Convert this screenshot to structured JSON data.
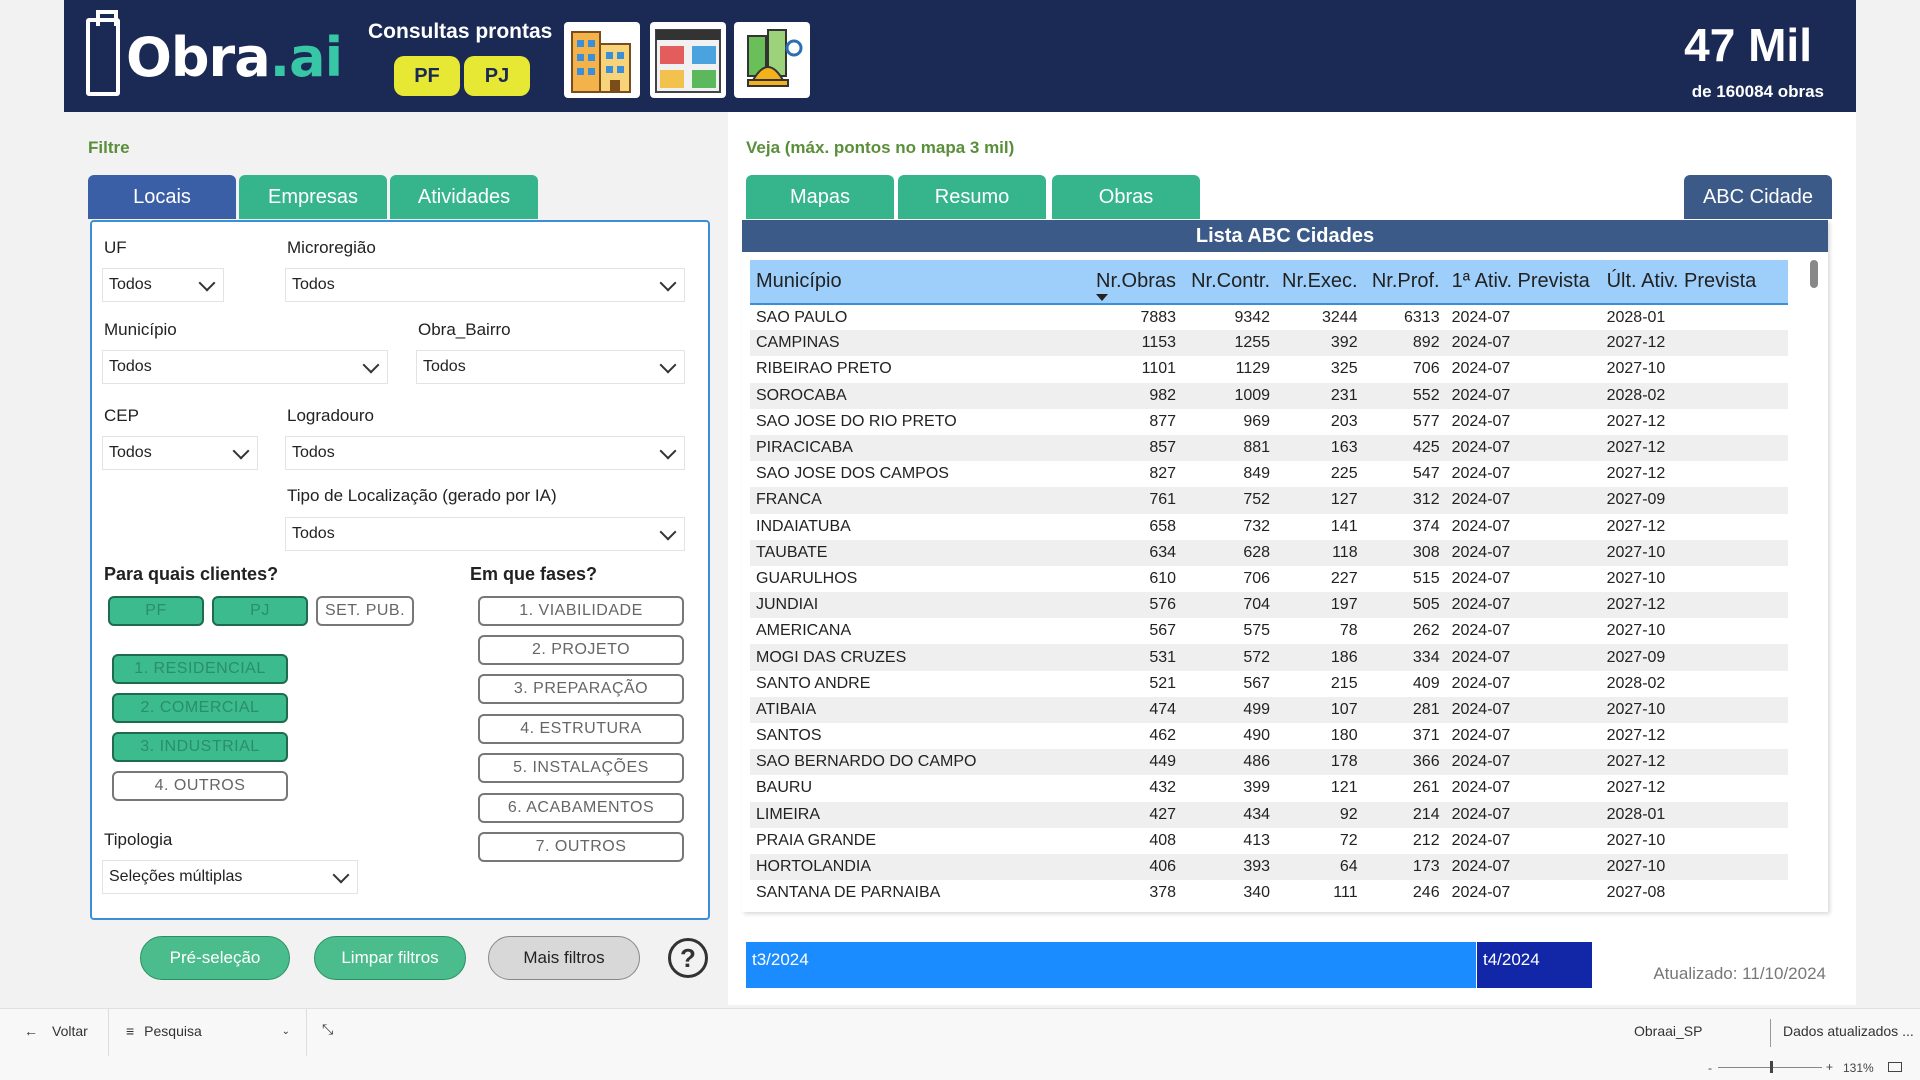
{
  "header": {
    "logo_main": "Obra",
    "logo_accent": ".ai",
    "consultas_label": "Consultas prontas",
    "btn_pf": "PF",
    "btn_pj": "PJ",
    "stat_big": "47 Mil",
    "stat_small": "de 160084 obras"
  },
  "left": {
    "section_label": "Filtre",
    "tabs": [
      "Locais",
      "Empresas",
      "Atividades"
    ],
    "filters": {
      "uf_label": "UF",
      "uf_value": "Todos",
      "micro_label": "Microregião",
      "micro_value": "Todos",
      "municipio_label": "Município",
      "municipio_value": "Todos",
      "bairro_label": "Obra_Bairro",
      "bairro_value": "Todos",
      "cep_label": "CEP",
      "cep_value": "Todos",
      "logradouro_label": "Logradouro",
      "logradouro_value": "Todos",
      "tipo_label": "Tipo de Localização (gerado por IA)",
      "tipo_value": "Todos",
      "tipologia_label": "Tipologia",
      "tipologia_value": "Seleções múltiplas"
    },
    "clientes_label": "Para quais clientes?",
    "clientes": [
      "PF",
      "PJ",
      "SET. PUB."
    ],
    "segmentos": [
      "1. RESIDENCIAL",
      "2. COMERCIAL",
      "3. INDUSTRIAL",
      "4. OUTROS"
    ],
    "fases_label": "Em que fases?",
    "fases": [
      "1. VIABILIDADE",
      "2. PROJETO",
      "3. PREPARAÇÃO",
      "4. ESTRUTURA",
      "5. INSTALAÇÕES",
      "6. ACABAMENTOS",
      "7. OUTROS"
    ],
    "buttons": {
      "preselecao": "Pré-seleção",
      "limpar": "Limpar filtros",
      "mais": "Mais filtros",
      "help": "?"
    }
  },
  "right": {
    "section_label": "Veja (máx. pontos no mapa 3 mil)",
    "tabs": [
      "Mapas",
      "Resumo",
      "Obras"
    ],
    "active_tab": "ABC Cidade",
    "table_title": "Lista ABC Cidades",
    "columns": [
      "Município",
      "Nr.Obras",
      "Nr.Contr.",
      "Nr.Exec.",
      "Nr.Prof.",
      "1ª Ativ. Prevista",
      "Últ. Ativ. Prevista"
    ],
    "rows": [
      [
        "SAO PAULO",
        "7883",
        "9342",
        "3244",
        "6313",
        "2024-07",
        "2028-01"
      ],
      [
        "CAMPINAS",
        "1153",
        "1255",
        "392",
        "892",
        "2024-07",
        "2027-12"
      ],
      [
        "RIBEIRAO PRETO",
        "1101",
        "1129",
        "325",
        "706",
        "2024-07",
        "2027-10"
      ],
      [
        "SOROCABA",
        "982",
        "1009",
        "231",
        "552",
        "2024-07",
        "2028-02"
      ],
      [
        "SAO JOSE DO RIO PRETO",
        "877",
        "969",
        "203",
        "577",
        "2024-07",
        "2027-12"
      ],
      [
        "PIRACICABA",
        "857",
        "881",
        "163",
        "425",
        "2024-07",
        "2027-12"
      ],
      [
        "SAO JOSE DOS CAMPOS",
        "827",
        "849",
        "225",
        "547",
        "2024-07",
        "2027-12"
      ],
      [
        "FRANCA",
        "761",
        "752",
        "127",
        "312",
        "2024-07",
        "2027-09"
      ],
      [
        "INDAIATUBA",
        "658",
        "732",
        "141",
        "374",
        "2024-07",
        "2027-12"
      ],
      [
        "TAUBATE",
        "634",
        "628",
        "118",
        "308",
        "2024-07",
        "2027-10"
      ],
      [
        "GUARULHOS",
        "610",
        "706",
        "227",
        "515",
        "2024-07",
        "2027-10"
      ],
      [
        "JUNDIAI",
        "576",
        "704",
        "197",
        "505",
        "2024-07",
        "2027-12"
      ],
      [
        "AMERICANA",
        "567",
        "575",
        "78",
        "262",
        "2024-07",
        "2027-10"
      ],
      [
        "MOGI DAS CRUZES",
        "531",
        "572",
        "186",
        "334",
        "2024-07",
        "2027-09"
      ],
      [
        "SANTO ANDRE",
        "521",
        "567",
        "215",
        "409",
        "2024-07",
        "2028-02"
      ],
      [
        "ATIBAIA",
        "474",
        "499",
        "107",
        "281",
        "2024-07",
        "2027-10"
      ],
      [
        "SANTOS",
        "462",
        "490",
        "180",
        "371",
        "2024-07",
        "2027-12"
      ],
      [
        "SAO BERNARDO DO CAMPO",
        "449",
        "486",
        "178",
        "366",
        "2024-07",
        "2027-12"
      ],
      [
        "BAURU",
        "432",
        "399",
        "121",
        "261",
        "2024-07",
        "2027-12"
      ],
      [
        "LIMEIRA",
        "427",
        "434",
        "92",
        "214",
        "2024-07",
        "2028-01"
      ],
      [
        "PRAIA GRANDE",
        "408",
        "413",
        "72",
        "212",
        "2024-07",
        "2027-10"
      ],
      [
        "HORTOLANDIA",
        "406",
        "393",
        "64",
        "173",
        "2024-07",
        "2027-10"
      ],
      [
        "SANTANA DE PARNAIBA",
        "378",
        "340",
        "111",
        "246",
        "2024-07",
        "2027-08"
      ]
    ],
    "timeline": [
      "t3/2024",
      "t4/2024"
    ],
    "updated": "Atualizado: 11/10/2024"
  },
  "statusbar": {
    "back": "Voltar",
    "search": "Pesquisa",
    "page": "Obraai_SP",
    "data_status": "Dados atualizados ...",
    "zoom": "131%"
  }
}
